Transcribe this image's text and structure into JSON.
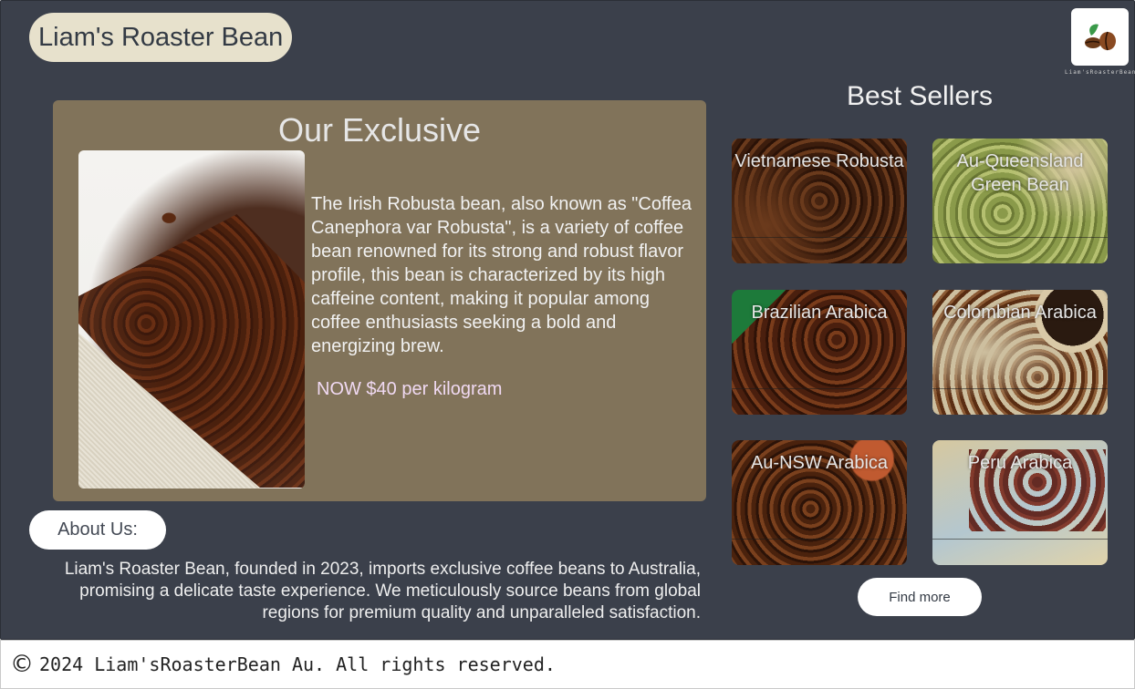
{
  "header": {
    "brand": "Liam's Roaster Bean",
    "logo_caption": "Liam'sRoasterBean"
  },
  "exclusive": {
    "title": "Our Exclusive",
    "description": "The Irish Robusta bean, also known as \"Coffea Canephora var Robusta\", is a variety of coffee bean renowned for its strong and robust flavor profile, this bean is characterized by its high caffeine content, making it popular among coffee enthusiasts seeking a bold and energizing brew.",
    "price": "NOW $40 per kilogram"
  },
  "about": {
    "button_label": "About Us:",
    "text": "Liam's Roaster Bean, founded in 2023, imports exclusive coffee beans to Australia, promising a delicate taste experience. We meticulously source beans from global regions for premium quality and unparalleled satisfaction."
  },
  "best_sellers": {
    "title": "Best Sellers",
    "items": [
      {
        "label": "Vietnamese Robusta"
      },
      {
        "label": "Au-Queensland Green Bean"
      },
      {
        "label": "Brazilian Arabica"
      },
      {
        "label": "Colombian Arabica"
      },
      {
        "label": "Au-NSW Arabica"
      },
      {
        "label": "Peru Arabica"
      }
    ],
    "find_more_label": "Find more"
  },
  "footer": {
    "copyright_symbol": "©",
    "text": "2024 Liam'sRoasterBean Au. All rights reserved."
  },
  "icons": {
    "logo": "coffee-beans-leaf-icon",
    "copyright": "copyright-icon"
  }
}
